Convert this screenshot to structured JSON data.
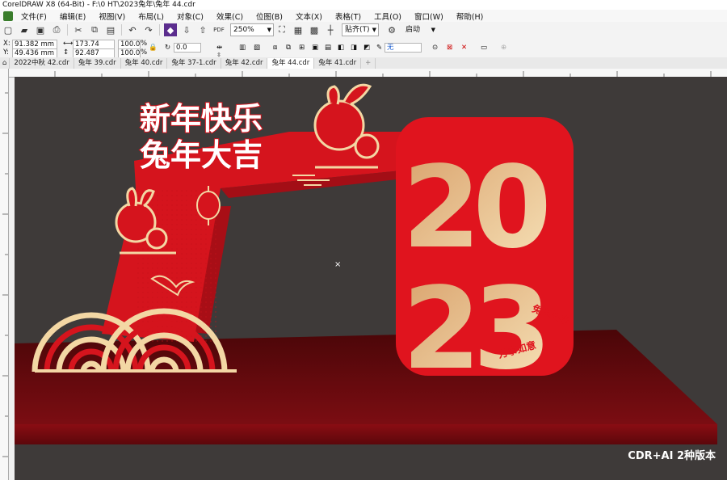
{
  "window": {
    "title": "CorelDRAW X8 (64-Bit) - F:\\0 HT\\2023兔年\\兔年 44.cdr"
  },
  "menu": [
    "文件(F)",
    "编辑(E)",
    "视图(V)",
    "布局(L)",
    "对象(C)",
    "效果(C)",
    "位图(B)",
    "文本(X)",
    "表格(T)",
    "工具(O)",
    "窗口(W)",
    "帮助(H)"
  ],
  "toolbar": {
    "zoom": "250%",
    "snap": "贴齐(T)",
    "launch": "启动"
  },
  "props": {
    "x": "91.382 mm",
    "y": "49.436 mm",
    "w": "173.74 mm",
    "h": "92.487 mm",
    "sx": "100.0",
    "sy": "100.0",
    "pct": "%",
    "angle": "0.0",
    "x_label": "X:",
    "y_label": "Y:",
    "fill": "无"
  },
  "tabs": [
    "2022中秋 42.cdr",
    "兔年 39.cdr",
    "兔年 40.cdr",
    "兔年 37-1.cdr",
    "兔年 42.cdr",
    "兔年 44.cdr",
    "兔年 41.cdr"
  ],
  "active_tab": "兔年 44.cdr",
  "artwork": {
    "line1": "新年快乐",
    "line2": "兔年大吉",
    "digits_top": "20",
    "digits_bottom": "23",
    "blessing1": "兔兔纳福",
    "blessing2": "万事如意"
  },
  "watermark": "CDR+AI 2种版本",
  "colors": {
    "red": "#e0141e",
    "darkred": "#8a0d13",
    "gold": "#f3d7a4",
    "canvas": "#3e3a39"
  }
}
